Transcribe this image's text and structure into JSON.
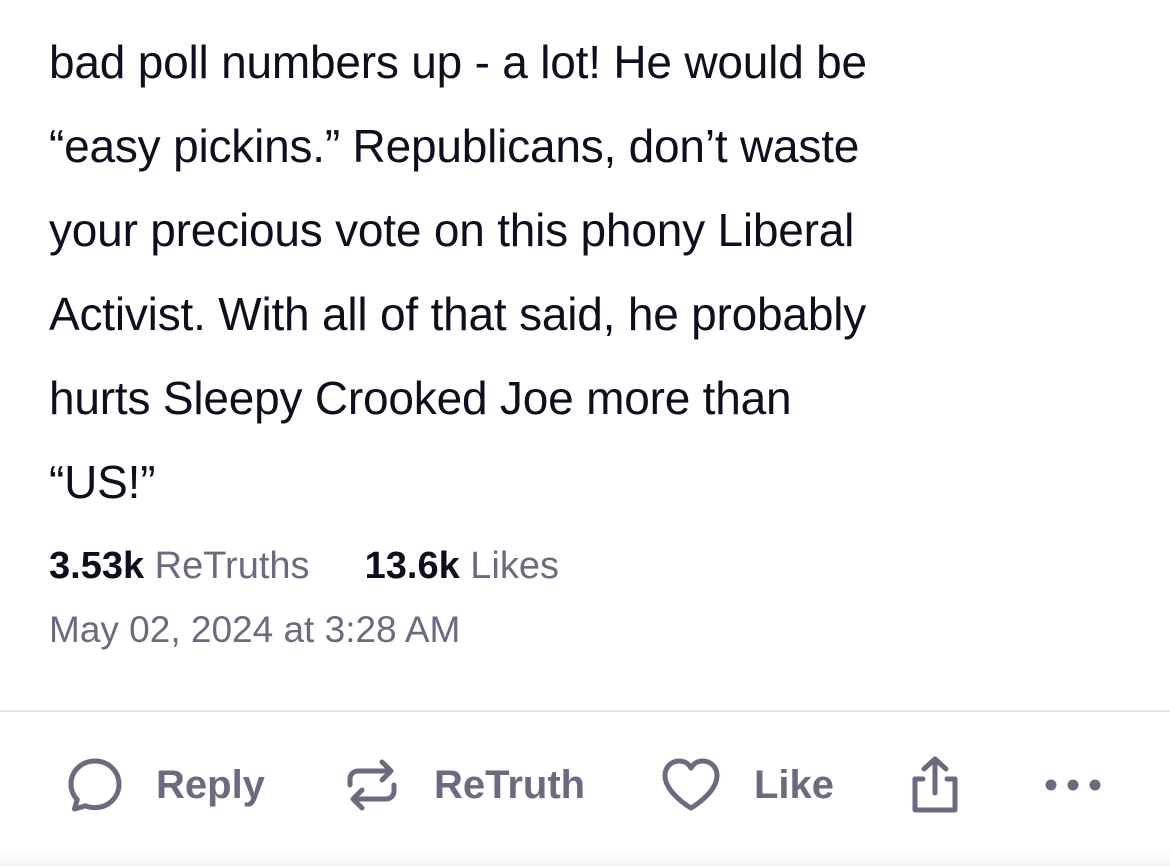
{
  "post": {
    "lines": [
      "bad poll numbers up - a lot! He would be",
      "“easy pickins.” Republicans, don’t waste",
      "your precious vote on this phony Liberal",
      "Activist. With all of that said, he probably",
      "hurts Sleepy Crooked Joe more than",
      "“US!”"
    ]
  },
  "stats": {
    "retruths_count": "3.53k",
    "retruths_label": "ReTruths",
    "likes_count": "13.6k",
    "likes_label": "Likes"
  },
  "timestamp": "May 02, 2024 at 3:28 AM",
  "actions": {
    "reply_label": "Reply",
    "retruth_label": "ReTruth",
    "like_label": "Like",
    "reply_icon": "speech-bubble-icon",
    "retruth_icon": "repost-arrows-icon",
    "like_icon": "heart-icon",
    "share_icon": "share-upload-icon",
    "more_icon": "ellipsis-icon"
  },
  "colors": {
    "text_primary": "#0f0d1f",
    "text_secondary": "#6c6a80",
    "icon": "#6c6a80",
    "divider": "#e8e7ee"
  }
}
